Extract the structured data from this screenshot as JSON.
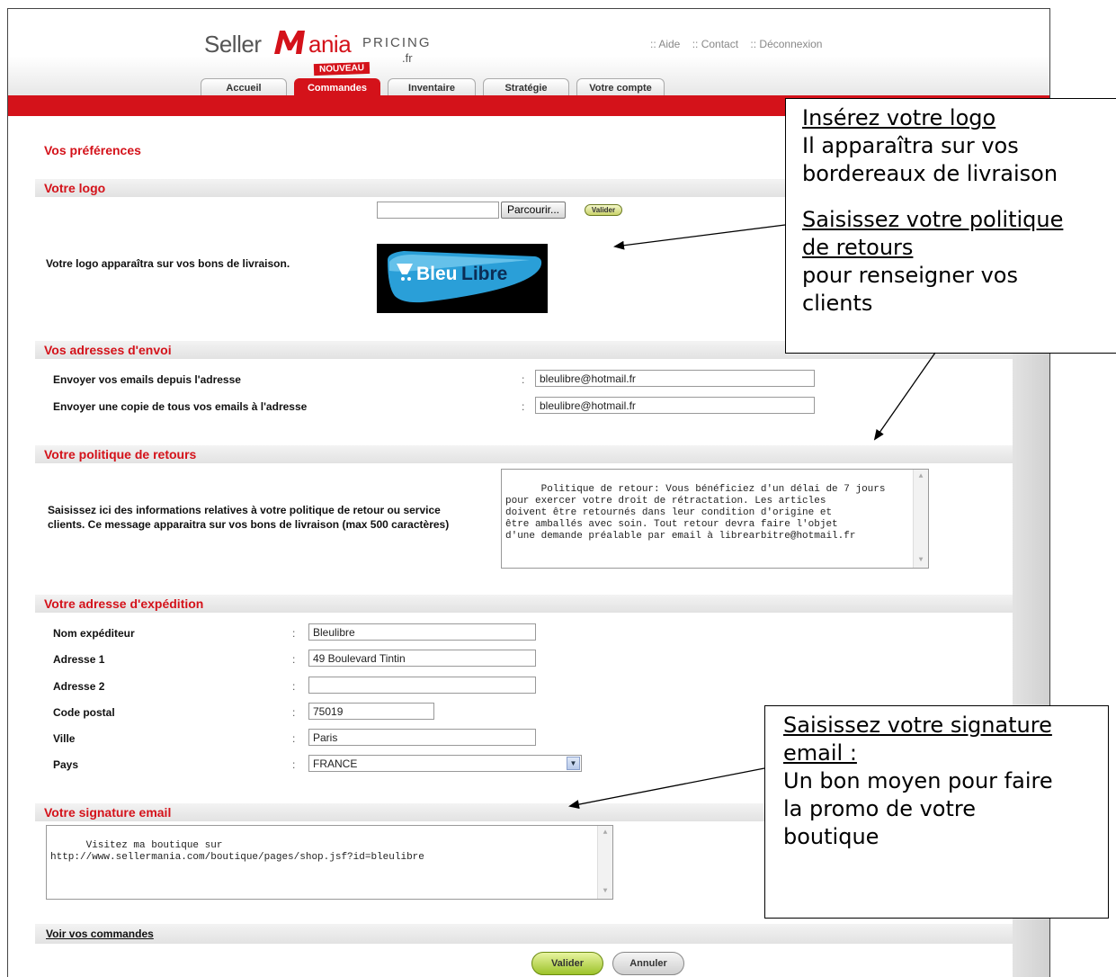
{
  "app": {
    "logo_seller": "Seller",
    "logo_ania": "ania",
    "logo_pricing": "PRICING",
    "logo_fr": ".fr",
    "brand_color": "#d4121a"
  },
  "top_links": [
    ":: Aide",
    ":: Contact",
    ":: Déconnexion"
  ],
  "badge_new": "NOUVEAU",
  "tabs": [
    {
      "label": "Accueil",
      "active": false
    },
    {
      "label": "Commandes",
      "active": true
    },
    {
      "label": "Inventaire",
      "active": false
    },
    {
      "label": "Stratégie",
      "active": false
    },
    {
      "label": "Votre compte",
      "active": false
    }
  ],
  "page_title": "Vos préférences",
  "logo_section": {
    "heading": "Votre logo",
    "file_value": "",
    "browse_label": "Parcourir...",
    "validate_label": "Valider",
    "description": "Votre logo apparaîtra sur vos bons de livraison.",
    "image_text_a": "Bleu",
    "image_text_b": "Libre"
  },
  "addresses_section": {
    "heading": "Vos adresses d'envoi",
    "fields": [
      {
        "label": "Envoyer vos emails depuis l'adresse",
        "value": "bleulibre@hotmail.fr"
      },
      {
        "label": "Envoyer une copie de tous vos emails à l'adresse",
        "value": "bleulibre@hotmail.fr"
      }
    ]
  },
  "returns_section": {
    "heading": "Votre politique de retours",
    "description_line1": "Saisissez ici des informations relatives à votre politique de retour ou service",
    "description_line2": "clients. Ce message apparaitra sur vos bons de livraison (max 500 caractères)",
    "text": "Politique de retour: Vous bénéficiez d'un délai de 7 jours\npour exercer votre droit de rétractation. Les articles\ndoivent être retournés dans leur condition d'origine et\nêtre amballés avec soin. Tout retour devra faire l'objet\nd'une demande préalable par email à librearbitre@hotmail.fr"
  },
  "shipping_section": {
    "heading": "Votre adresse d'expédition",
    "fields": [
      {
        "label": "Nom expéditeur",
        "value": "Bleulibre"
      },
      {
        "label": "Adresse 1",
        "value": "49 Boulevard Tintin"
      },
      {
        "label": "Adresse 2",
        "value": ""
      },
      {
        "label": "Code postal",
        "value": "75019"
      },
      {
        "label": "Ville",
        "value": "Paris"
      },
      {
        "label": "Pays",
        "value": "FRANCE"
      }
    ]
  },
  "signature_section": {
    "heading": "Votre signature email",
    "text": "Visitez ma boutique sur\nhttp://www.sellermania.com/boutique/pages/shop.jsf?id=bleulibre"
  },
  "footer": {
    "orders_link": "Voir vos commandes",
    "validate_label": "Valider",
    "cancel_label": "Annuler"
  },
  "callouts": {
    "logo": {
      "title": "Insérez votre logo",
      "line1": "Il apparaîtra sur vos",
      "line2": "bordereaux de livraison"
    },
    "returns": {
      "title_line1": "Saisissez votre politique",
      "title_line2": "de retours",
      "line1": "pour renseigner vos",
      "line2": "clients"
    },
    "signature": {
      "title_line1": "Saisissez votre signature",
      "title_line2": "email :",
      "line1": "Un bon moyen pour faire",
      "line2": "la promo de votre",
      "line3": "boutique"
    }
  }
}
